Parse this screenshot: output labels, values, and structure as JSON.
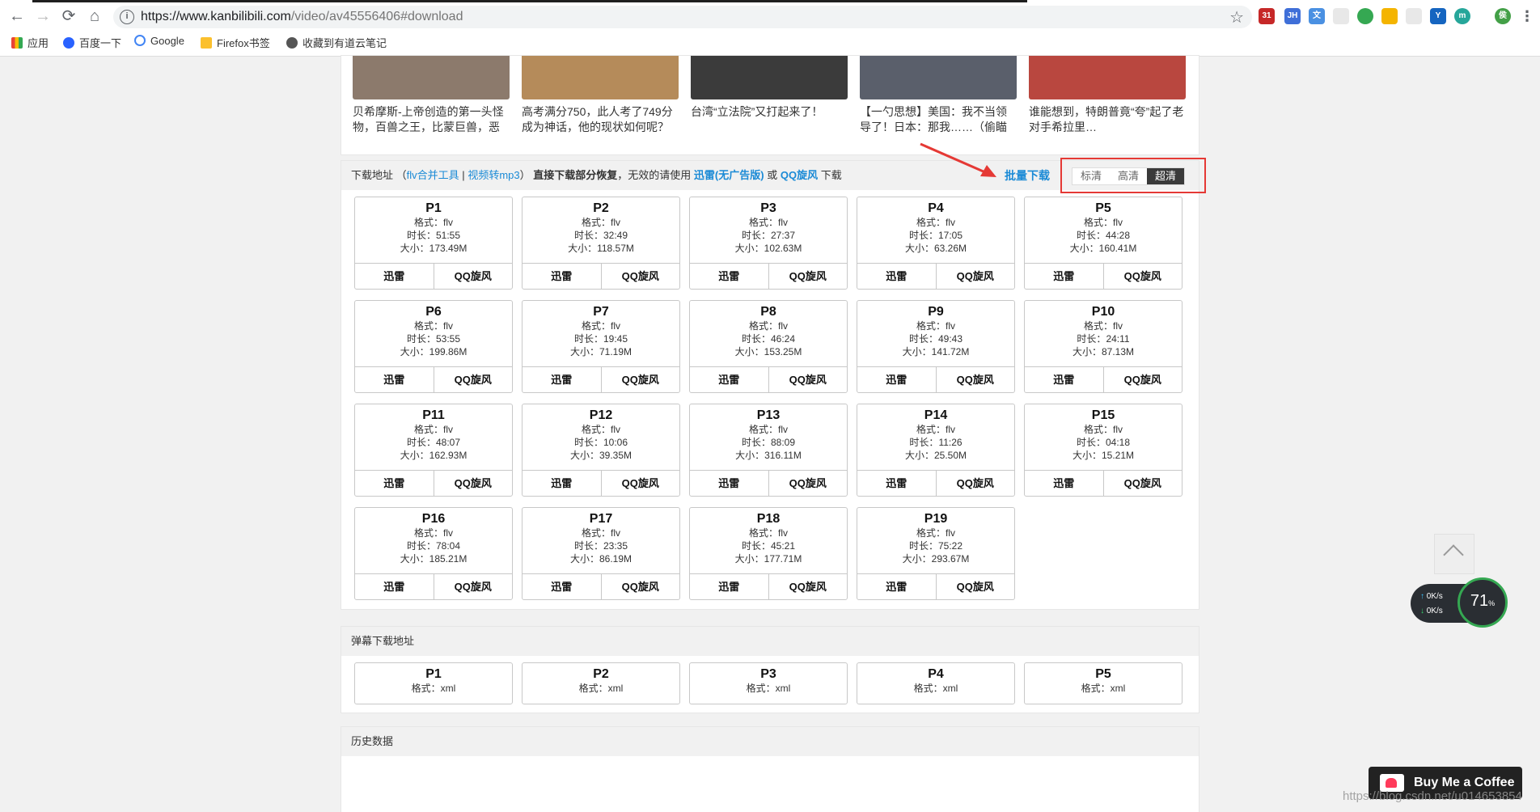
{
  "browser": {
    "url_base": "https://www.kanbilibili.com",
    "url_path": "/video/av45556406#download",
    "bookmarks": [
      "应用",
      "百度一下",
      "Google",
      "Firefox书签",
      "收藏到有道云笔记"
    ],
    "extension_badge": "31"
  },
  "videos": [
    {
      "title": "贝希摩斯-上帝创造的第一头怪物，百兽之王，比蒙巨兽，恶",
      "thumb_color": "#8c7a6c"
    },
    {
      "title": "高考满分750，此人考了749分成为神话，他的现状如何呢？",
      "thumb_color": "#b58b5a"
    },
    {
      "title": "台湾“立法院”又打起来了！",
      "thumb_color": "#3b3b3b"
    },
    {
      "title": "【一勺思想】美国：我不当领导了！日本：那我……（偷瞄中",
      "thumb_color": "#5a5f6b"
    },
    {
      "title": "谁能想到，特朗普竟“夸”起了老对手希拉里…",
      "thumb_color": "#b9473f"
    }
  ],
  "download": {
    "label": "下载地址",
    "paren_open": "（",
    "tool_link": "flv合并工具",
    "sep": "|",
    "mp3_link": "视频转mp3",
    "paren_close": "）",
    "bold_text": "直接下载部分恢复",
    "note": "，无效的请使用",
    "xunlei_link": "迅雷(无广告版)",
    "or": "或",
    "qq_link": "QQ旋风",
    "tail": "下载",
    "batch": "批量下载",
    "quality_options": [
      "标清",
      "高清",
      "超清"
    ],
    "quality_selected": "超清",
    "format_label": "格式：",
    "duration_label": "时长：",
    "size_label": "大小：",
    "btn_xunlei": "迅雷",
    "btn_qq": "QQ旋风",
    "parts": [
      {
        "name": "P1",
        "format": "flv",
        "duration": "51:55",
        "size": "173.49M"
      },
      {
        "name": "P2",
        "format": "flv",
        "duration": "32:49",
        "size": "118.57M"
      },
      {
        "name": "P3",
        "format": "flv",
        "duration": "27:37",
        "size": "102.63M"
      },
      {
        "name": "P4",
        "format": "flv",
        "duration": "17:05",
        "size": "63.26M"
      },
      {
        "name": "P5",
        "format": "flv",
        "duration": "44:28",
        "size": "160.41M"
      },
      {
        "name": "P6",
        "format": "flv",
        "duration": "53:55",
        "size": "199.86M"
      },
      {
        "name": "P7",
        "format": "flv",
        "duration": "19:45",
        "size": "71.19M"
      },
      {
        "name": "P8",
        "format": "flv",
        "duration": "46:24",
        "size": "153.25M"
      },
      {
        "name": "P9",
        "format": "flv",
        "duration": "49:43",
        "size": "141.72M"
      },
      {
        "name": "P10",
        "format": "flv",
        "duration": "24:11",
        "size": "87.13M"
      },
      {
        "name": "P11",
        "format": "flv",
        "duration": "48:07",
        "size": "162.93M"
      },
      {
        "name": "P12",
        "format": "flv",
        "duration": "10:06",
        "size": "39.35M"
      },
      {
        "name": "P13",
        "format": "flv",
        "duration": "88:09",
        "size": "316.11M"
      },
      {
        "name": "P14",
        "format": "flv",
        "duration": "11:26",
        "size": "25.50M"
      },
      {
        "name": "P15",
        "format": "flv",
        "duration": "04:18",
        "size": "15.21M"
      },
      {
        "name": "P16",
        "format": "flv",
        "duration": "78:04",
        "size": "185.21M"
      },
      {
        "name": "P17",
        "format": "flv",
        "duration": "23:35",
        "size": "86.19M"
      },
      {
        "name": "P18",
        "format": "flv",
        "duration": "45:21",
        "size": "177.71M"
      },
      {
        "name": "P19",
        "format": "flv",
        "duration": "75:22",
        "size": "293.67M"
      }
    ]
  },
  "danmaku": {
    "label": "弹幕下载地址",
    "parts": [
      {
        "name": "P1",
        "format": "xml"
      },
      {
        "name": "P2",
        "format": "xml"
      },
      {
        "name": "P3",
        "format": "xml"
      },
      {
        "name": "P4",
        "format": "xml"
      },
      {
        "name": "P5",
        "format": "xml"
      }
    ]
  },
  "history": {
    "label": "历史数据"
  },
  "speed_widget": {
    "up": "0",
    "down": "0",
    "unit": "K/s",
    "percent": "71",
    "percent_sign": "%"
  },
  "coffee": {
    "label": "Buy Me a Coffee"
  },
  "watermark": "https://blog.csdn.net/u014653854"
}
